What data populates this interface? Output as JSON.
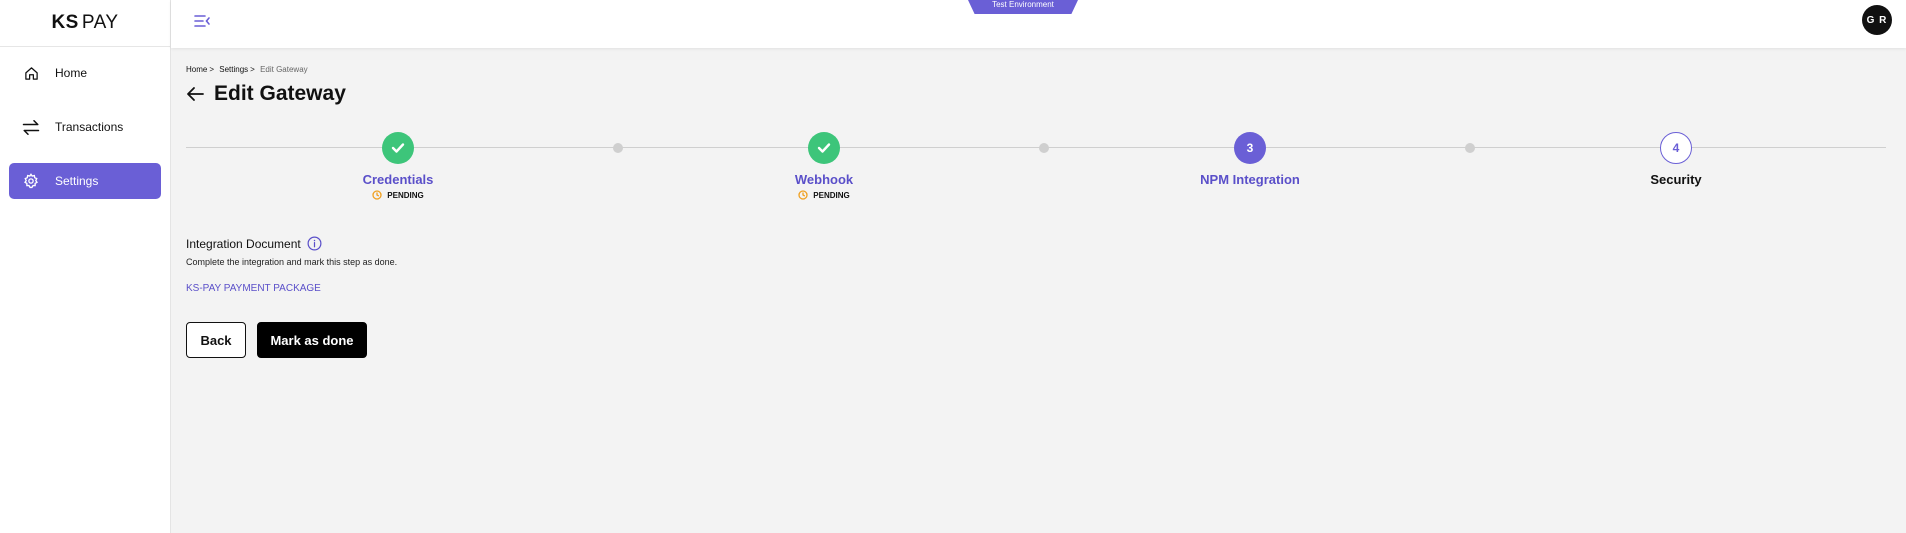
{
  "app": {
    "logo_ks": "KS",
    "logo_pay": "PAY",
    "environment": "Test Environment",
    "avatar_initials": "G R"
  },
  "sidebar": {
    "items": [
      {
        "label": "Home",
        "icon": "home-icon",
        "active": false
      },
      {
        "label": "Transactions",
        "icon": "swap-arrows-icon",
        "active": false
      },
      {
        "label": "Settings",
        "icon": "gear-icon",
        "active": true
      }
    ]
  },
  "breadcrumb": {
    "items": [
      "Home",
      "Settings",
      "Edit Gateway"
    ],
    "separator": ">"
  },
  "page": {
    "title": "Edit Gateway"
  },
  "stepper": {
    "steps": [
      {
        "label": "Credentials",
        "state": "done",
        "number": "",
        "status": "PENDING"
      },
      {
        "label": "Webhook",
        "state": "done",
        "number": "",
        "status": "PENDING"
      },
      {
        "label": "NPM Integration",
        "state": "current",
        "number": "3",
        "status": ""
      },
      {
        "label": "Security",
        "state": "todo",
        "number": "4",
        "status": ""
      }
    ]
  },
  "integration": {
    "title": "Integration Document",
    "description": "Complete the integration and mark this step as done.",
    "link_label": "KS-PAY PAYMENT PACKAGE"
  },
  "actions": {
    "back_label": "Back",
    "done_label": "Mark as done"
  },
  "colors": {
    "accent": "#6a5fd6",
    "success": "#3dc57a",
    "pending": "#f0a020"
  }
}
